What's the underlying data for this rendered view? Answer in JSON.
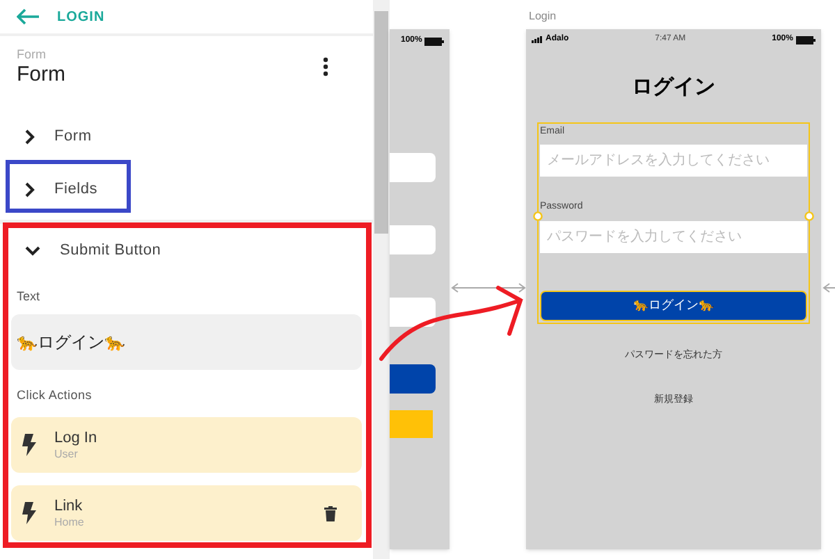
{
  "header": {
    "back_label": "LOGIN"
  },
  "component": {
    "type_label": "Form",
    "name": "Form"
  },
  "sections": [
    {
      "label": "Form",
      "expanded": false
    },
    {
      "label": "Fields",
      "expanded": false
    },
    {
      "label": "Submit Button",
      "expanded": true
    }
  ],
  "submit_button": {
    "text_label": "Text",
    "text_value": "🐆ログイン🐆",
    "click_actions_label": "Click Actions",
    "actions": [
      {
        "title": "Log In",
        "subtitle": "User",
        "deletable": false
      },
      {
        "title": "Link",
        "subtitle": "Home",
        "deletable": true
      }
    ]
  },
  "canvas": {
    "prev_screen": {
      "battery": "100%"
    },
    "screen": {
      "label": "Login",
      "carrier": "Adalo",
      "time": "7:47 AM",
      "battery": "100%",
      "title": "ログイン",
      "fields": [
        {
          "label": "Email",
          "placeholder": "メールアドレスを入力してください"
        },
        {
          "label": "Password",
          "placeholder": "パスワードを入力してください"
        }
      ],
      "button": "🐆ログイン🐆",
      "links": [
        "パスワードを忘れた方",
        "新規登録"
      ]
    }
  }
}
